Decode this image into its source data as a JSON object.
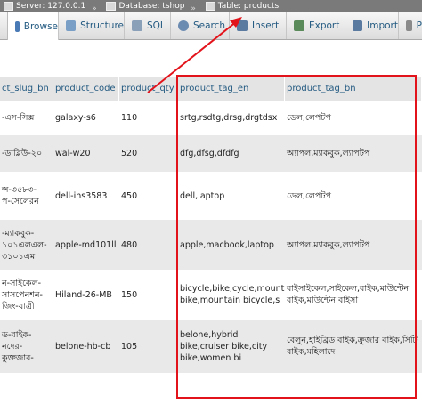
{
  "breadcrumb": {
    "server": "Server: 127.0.0.1",
    "database": "Database: tshop",
    "table": "Table: products",
    "separator": "»"
  },
  "tabs": [
    {
      "label": "Browse",
      "icon": "table-icon",
      "color": "#4a7ab5"
    },
    {
      "label": "Structure",
      "icon": "structure-icon",
      "color": "#7a9fc7"
    },
    {
      "label": "SQL",
      "icon": "sql-icon",
      "color": "#8aa0b8"
    },
    {
      "label": "Search",
      "icon": "search-icon",
      "color": "#6b8bb0"
    },
    {
      "label": "Insert",
      "icon": "insert-icon",
      "color": "#5a7aa0"
    },
    {
      "label": "Export",
      "icon": "export-icon",
      "color": "#5a8a5a"
    },
    {
      "label": "Import",
      "icon": "import-icon",
      "color": "#5a7aa0"
    },
    {
      "label": "P",
      "icon": "privileges-icon",
      "color": "#8a8a8a"
    }
  ],
  "columns": [
    "ct_slug_bn",
    "product_code",
    "product_qty",
    "product_tag_en",
    "product_tag_bn"
  ],
  "rows": [
    [
      "-এস-সিক্স",
      "galaxy-s6",
      "110",
      "srtg,rsdtg,drsg,drgtdsx",
      "ডেল,লেপটপ"
    ],
    [
      "-ডাব্লিউ-২০",
      "wal-w20",
      "520",
      "dfg,dfsg,dfdfg",
      "অ্যাপল,ম্যাকবুক,ল্যাপটপ"
    ],
    [
      "ন্স-৩৫৮৩-\nপ-সেলেরন",
      "dell-ins3583",
      "450",
      "dell,laptop",
      "ডেল,লেপটপ"
    ],
    [
      "-ম্যাকবুক-\n১০১এলএল-\n৩১০১এম",
      "apple-md101ll",
      "480",
      "apple,macbook,laptop",
      "অ্যাপল,ম্যাকবুক,ল্যাপটপ"
    ],
    [
      "ন-সাইকেল-\nসাসপেনশন-\nজিং-যাত্রী",
      "Hiland-26-MB",
      "150",
      "bicycle,bike,cycle,mountain bike,mountain bicycle,s",
      "বাইসাইকেল,সাইকেল,বাইক,মাউন্টেন বাইক,মাউন্টেন বাইসা"
    ],
    [
      "ড-বাইক-\nনদের-কুক্তজার-",
      "belone-hb-cb",
      "105",
      "belone,hybrid bike,cruiser bike,city bike,women bi",
      "বেলুন,হাইব্রিড বাইক,ক্রুজার বাইক,সিটি বাইক,মহিলাদে"
    ]
  ],
  "colors": {
    "highlight": "#e3131b",
    "link": "#235a81",
    "breadcrumb_bg": "#7a7a7a"
  }
}
